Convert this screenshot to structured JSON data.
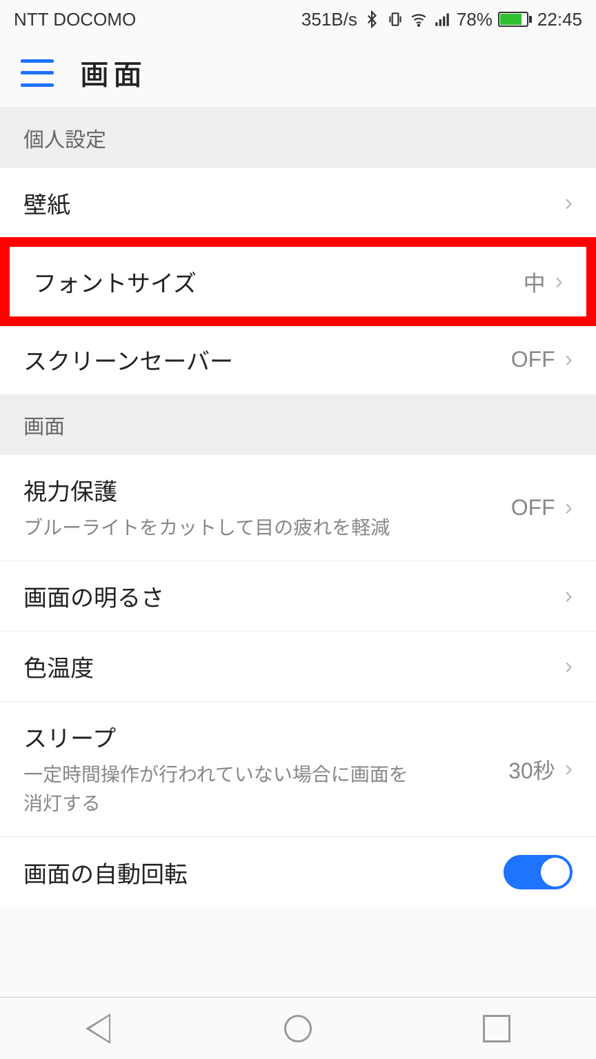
{
  "statusbar": {
    "carrier": "NTT DOCOMO",
    "data_rate": "351B/s",
    "battery_pct": "78%",
    "time": "22:45"
  },
  "header": {
    "title": "画面"
  },
  "sections": [
    {
      "header": "個人設定",
      "rows": [
        {
          "name": "wallpaper",
          "title": "壁紙",
          "value": "",
          "chevron": true,
          "highlight": false
        },
        {
          "name": "fontsize",
          "title": "フォントサイズ",
          "value": "中",
          "chevron": true,
          "highlight": true
        },
        {
          "name": "screensaver",
          "title": "スクリーンセーバー",
          "value": "OFF",
          "chevron": true,
          "highlight": false
        }
      ]
    },
    {
      "header": "画面",
      "rows": [
        {
          "name": "eye-comfort",
          "title": "視力保護",
          "sub": "ブルーライトをカットして目の疲れを軽減",
          "value": "OFF",
          "chevron": true
        },
        {
          "name": "brightness",
          "title": "画面の明るさ",
          "value": "",
          "chevron": true
        },
        {
          "name": "color-temp",
          "title": "色温度",
          "value": "",
          "chevron": true
        },
        {
          "name": "sleep",
          "title": "スリープ",
          "sub": "一定時間操作が行われていない場合に画面を消灯する",
          "value": "30秒",
          "chevron": true
        },
        {
          "name": "auto-rotate",
          "title": "画面の自動回転",
          "toggle": true,
          "toggle_on": true
        }
      ]
    }
  ]
}
